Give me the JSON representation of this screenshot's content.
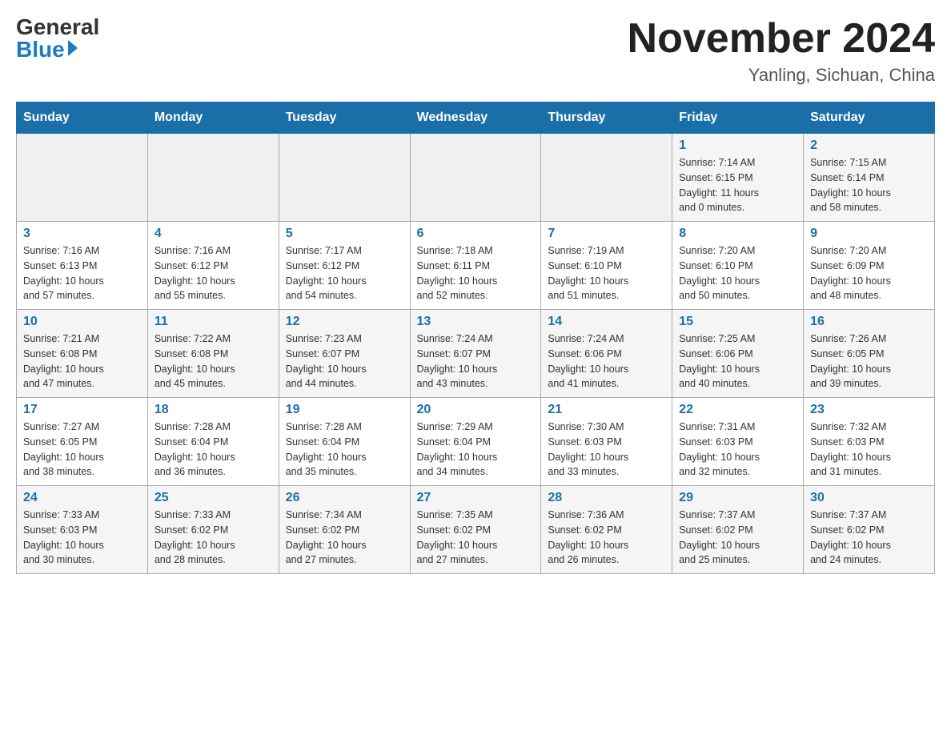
{
  "logo": {
    "general": "General",
    "blue": "Blue"
  },
  "title": "November 2024",
  "location": "Yanling, Sichuan, China",
  "days_of_week": [
    "Sunday",
    "Monday",
    "Tuesday",
    "Wednesday",
    "Thursday",
    "Friday",
    "Saturday"
  ],
  "weeks": [
    [
      {
        "day": "",
        "info": ""
      },
      {
        "day": "",
        "info": ""
      },
      {
        "day": "",
        "info": ""
      },
      {
        "day": "",
        "info": ""
      },
      {
        "day": "",
        "info": ""
      },
      {
        "day": "1",
        "info": "Sunrise: 7:14 AM\nSunset: 6:15 PM\nDaylight: 11 hours\nand 0 minutes."
      },
      {
        "day": "2",
        "info": "Sunrise: 7:15 AM\nSunset: 6:14 PM\nDaylight: 10 hours\nand 58 minutes."
      }
    ],
    [
      {
        "day": "3",
        "info": "Sunrise: 7:16 AM\nSunset: 6:13 PM\nDaylight: 10 hours\nand 57 minutes."
      },
      {
        "day": "4",
        "info": "Sunrise: 7:16 AM\nSunset: 6:12 PM\nDaylight: 10 hours\nand 55 minutes."
      },
      {
        "day": "5",
        "info": "Sunrise: 7:17 AM\nSunset: 6:12 PM\nDaylight: 10 hours\nand 54 minutes."
      },
      {
        "day": "6",
        "info": "Sunrise: 7:18 AM\nSunset: 6:11 PM\nDaylight: 10 hours\nand 52 minutes."
      },
      {
        "day": "7",
        "info": "Sunrise: 7:19 AM\nSunset: 6:10 PM\nDaylight: 10 hours\nand 51 minutes."
      },
      {
        "day": "8",
        "info": "Sunrise: 7:20 AM\nSunset: 6:10 PM\nDaylight: 10 hours\nand 50 minutes."
      },
      {
        "day": "9",
        "info": "Sunrise: 7:20 AM\nSunset: 6:09 PM\nDaylight: 10 hours\nand 48 minutes."
      }
    ],
    [
      {
        "day": "10",
        "info": "Sunrise: 7:21 AM\nSunset: 6:08 PM\nDaylight: 10 hours\nand 47 minutes."
      },
      {
        "day": "11",
        "info": "Sunrise: 7:22 AM\nSunset: 6:08 PM\nDaylight: 10 hours\nand 45 minutes."
      },
      {
        "day": "12",
        "info": "Sunrise: 7:23 AM\nSunset: 6:07 PM\nDaylight: 10 hours\nand 44 minutes."
      },
      {
        "day": "13",
        "info": "Sunrise: 7:24 AM\nSunset: 6:07 PM\nDaylight: 10 hours\nand 43 minutes."
      },
      {
        "day": "14",
        "info": "Sunrise: 7:24 AM\nSunset: 6:06 PM\nDaylight: 10 hours\nand 41 minutes."
      },
      {
        "day": "15",
        "info": "Sunrise: 7:25 AM\nSunset: 6:06 PM\nDaylight: 10 hours\nand 40 minutes."
      },
      {
        "day": "16",
        "info": "Sunrise: 7:26 AM\nSunset: 6:05 PM\nDaylight: 10 hours\nand 39 minutes."
      }
    ],
    [
      {
        "day": "17",
        "info": "Sunrise: 7:27 AM\nSunset: 6:05 PM\nDaylight: 10 hours\nand 38 minutes."
      },
      {
        "day": "18",
        "info": "Sunrise: 7:28 AM\nSunset: 6:04 PM\nDaylight: 10 hours\nand 36 minutes."
      },
      {
        "day": "19",
        "info": "Sunrise: 7:28 AM\nSunset: 6:04 PM\nDaylight: 10 hours\nand 35 minutes."
      },
      {
        "day": "20",
        "info": "Sunrise: 7:29 AM\nSunset: 6:04 PM\nDaylight: 10 hours\nand 34 minutes."
      },
      {
        "day": "21",
        "info": "Sunrise: 7:30 AM\nSunset: 6:03 PM\nDaylight: 10 hours\nand 33 minutes."
      },
      {
        "day": "22",
        "info": "Sunrise: 7:31 AM\nSunset: 6:03 PM\nDaylight: 10 hours\nand 32 minutes."
      },
      {
        "day": "23",
        "info": "Sunrise: 7:32 AM\nSunset: 6:03 PM\nDaylight: 10 hours\nand 31 minutes."
      }
    ],
    [
      {
        "day": "24",
        "info": "Sunrise: 7:33 AM\nSunset: 6:03 PM\nDaylight: 10 hours\nand 30 minutes."
      },
      {
        "day": "25",
        "info": "Sunrise: 7:33 AM\nSunset: 6:02 PM\nDaylight: 10 hours\nand 28 minutes."
      },
      {
        "day": "26",
        "info": "Sunrise: 7:34 AM\nSunset: 6:02 PM\nDaylight: 10 hours\nand 27 minutes."
      },
      {
        "day": "27",
        "info": "Sunrise: 7:35 AM\nSunset: 6:02 PM\nDaylight: 10 hours\nand 27 minutes."
      },
      {
        "day": "28",
        "info": "Sunrise: 7:36 AM\nSunset: 6:02 PM\nDaylight: 10 hours\nand 26 minutes."
      },
      {
        "day": "29",
        "info": "Sunrise: 7:37 AM\nSunset: 6:02 PM\nDaylight: 10 hours\nand 25 minutes."
      },
      {
        "day": "30",
        "info": "Sunrise: 7:37 AM\nSunset: 6:02 PM\nDaylight: 10 hours\nand 24 minutes."
      }
    ]
  ]
}
